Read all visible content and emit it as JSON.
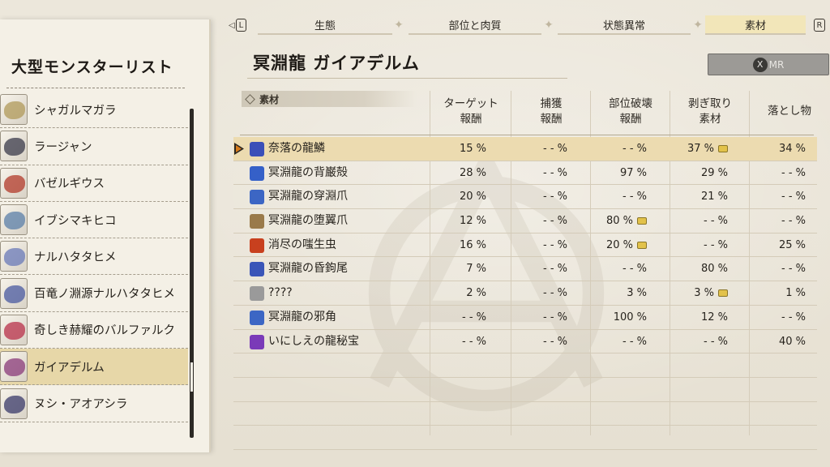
{
  "colors": {
    "selected_row": "#ecdbb0",
    "selected_list": "#e7d7a8",
    "cursor_accent": "#d77b1a",
    "active_tab": "#f2e6b9"
  },
  "tabs": {
    "left_key": "L",
    "right_key": "R",
    "items": [
      {
        "label": "生態",
        "active": false
      },
      {
        "label": "部位と肉質",
        "active": false
      },
      {
        "label": "状態異常",
        "active": false
      },
      {
        "label": "素材",
        "active": true
      }
    ]
  },
  "left_panel": {
    "title": "大型モンスターリスト",
    "monsters": [
      {
        "name": "シャガルマガラ",
        "icon": "monster-shagaru-icon",
        "color": "#b09a5a"
      },
      {
        "name": "ラージャン",
        "icon": "monster-rajang-icon",
        "color": "#3a3a4a"
      },
      {
        "name": "バゼルギウス",
        "icon": "monster-bazel-icon",
        "color": "#b23a2a"
      },
      {
        "name": "イブシマキヒコ",
        "icon": "monster-ibushi-icon",
        "color": "#5b7fa8"
      },
      {
        "name": "ナルハタタヒメ",
        "icon": "monster-narwa-icon",
        "color": "#6a7ab8"
      },
      {
        "name": "百竜ノ淵源ナルハタタヒメ",
        "icon": "monster-allmother-icon",
        "color": "#4a5aa0"
      },
      {
        "name": "奇しき赫耀のバルファルク",
        "icon": "monster-valstrax-icon",
        "color": "#b8304a"
      },
      {
        "name": "ガイアデルム",
        "icon": "monster-gaismagorm-icon",
        "color": "#8a3a7a",
        "selected": true
      },
      {
        "name": "ヌシ・アオアシラ",
        "icon": "monster-arzuros-icon",
        "color": "#3a3a6a"
      }
    ]
  },
  "header": {
    "monster_name": "冥淵龍 ガイアデルム",
    "mr_button_key": "X",
    "mr_button_label": "MR"
  },
  "table": {
    "section_label": "素材",
    "columns": [
      {
        "line1": "ターゲット",
        "line2": "報酬"
      },
      {
        "line1": "捕獲",
        "line2": "報酬"
      },
      {
        "line1": "部位破壊",
        "line2": "報酬"
      },
      {
        "line1": "剥ぎ取り",
        "line2": "素材"
      },
      {
        "line1": "落とし物",
        "line2": ""
      }
    ],
    "rows": [
      {
        "name": "奈落の龍鱗",
        "icon": "scale-icon",
        "icon_color": "#3b4fb8",
        "selected": true,
        "values": [
          "15 %",
          "- - %",
          "- - %",
          "37 %",
          "34 %"
        ],
        "marks": [
          false,
          false,
          false,
          true,
          false
        ]
      },
      {
        "name": "冥淵龍の背巌殻",
        "icon": "shell-icon",
        "icon_color": "#3560c8",
        "values": [
          "28 %",
          "- - %",
          "97 %",
          "29 %",
          "- - %"
        ],
        "marks": [
          false,
          false,
          false,
          false,
          false
        ]
      },
      {
        "name": "冥淵龍の穿淵爪",
        "icon": "claw-icon",
        "icon_color": "#3c66c4",
        "values": [
          "20 %",
          "- - %",
          "- - %",
          "21 %",
          "- - %"
        ],
        "marks": [
          false,
          false,
          false,
          false,
          false
        ]
      },
      {
        "name": "冥淵龍の堕翼爪",
        "icon": "wing-claw-icon",
        "icon_color": "#9a7a4a",
        "values": [
          "12 %",
          "- - %",
          "80 %",
          "- - %",
          "- - %"
        ],
        "marks": [
          false,
          false,
          true,
          false,
          false
        ]
      },
      {
        "name": "消尽の嗤生虫",
        "icon": "bug-icon",
        "icon_color": "#c8401e",
        "values": [
          "16 %",
          "- - %",
          "20 %",
          "- - %",
          "25 %"
        ],
        "marks": [
          false,
          false,
          true,
          false,
          false
        ]
      },
      {
        "name": "冥淵龍の昏鉤尾",
        "icon": "tail-icon",
        "icon_color": "#3a55b8",
        "values": [
          "7 %",
          "- - %",
          "- - %",
          "80 %",
          "- - %"
        ],
        "marks": [
          false,
          false,
          false,
          false,
          false
        ]
      },
      {
        "name": "????",
        "icon": "unknown-icon",
        "icon_color": "#9a9a9a",
        "values": [
          "2 %",
          "- - %",
          "3 %",
          "3 %",
          "1 %"
        ],
        "marks": [
          false,
          false,
          false,
          true,
          false
        ]
      },
      {
        "name": "冥淵龍の邪角",
        "icon": "horn-icon",
        "icon_color": "#3c66c4",
        "values": [
          "- - %",
          "- - %",
          "100 %",
          "12 %",
          "- - %"
        ],
        "marks": [
          false,
          false,
          false,
          false,
          false
        ]
      },
      {
        "name": "いにしえの龍秘宝",
        "icon": "treasure-icon",
        "icon_color": "#7a3ab8",
        "values": [
          "- - %",
          "- - %",
          "- - %",
          "- - %",
          "40 %"
        ],
        "marks": [
          false,
          false,
          false,
          false,
          false
        ]
      }
    ]
  }
}
